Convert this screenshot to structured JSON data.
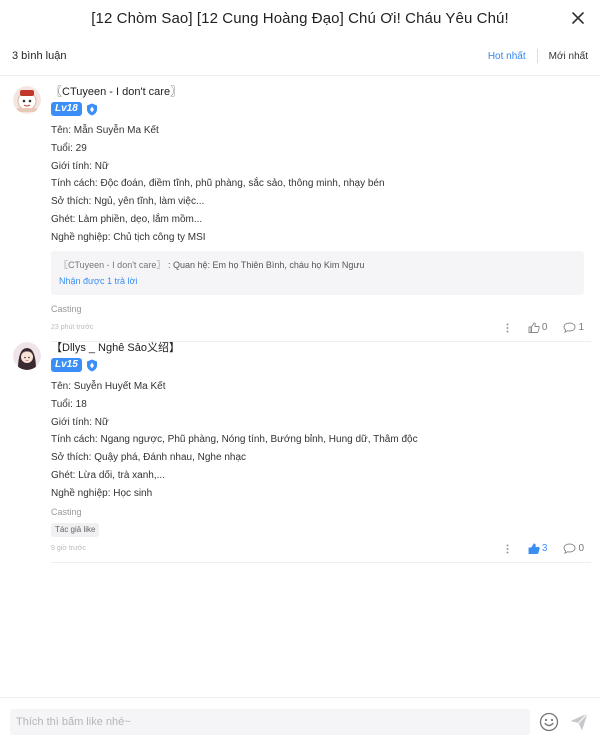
{
  "header": {
    "title": "[12 Chòm Sao] [12 Cung Hoàng Đạo] Chú Ơi! Cháu Yêu Chú!"
  },
  "subbar": {
    "count": "3 bình luận",
    "sort_hot": "Hot nhất",
    "sort_new": "Mới nhất"
  },
  "comments": [
    {
      "username": "〖CTuyeen - I don't care〗",
      "level": "Lv18",
      "lines": [
        "Tên: Mẫn Suyễn Ma Kết",
        "Tuổi: 29",
        "Giới tính: Nữ",
        "Tính cách: Độc đoán, điềm tĩnh, phũ phàng, sắc sảo, thông minh, nhạy bén",
        "Sở thích: Ngủ, yên tĩnh, làm việc...",
        "Ghét: Làm phiền, dẹo, lắm mồm...",
        "Nghề nghiệp: Chủ tịch công ty MSI"
      ],
      "reply": {
        "author": "〖CTuyeen - I don't care〗",
        "text": " : Quan hệ: Em họ Thiên Bình, cháu họ Kim Ngưu",
        "more": "Nhận được 1 trả lời"
      },
      "tag": "Casting",
      "time": "23 phút trước",
      "likes": "0",
      "replies": "1"
    },
    {
      "username": "【Dllys _ Nghê Sảo义绍】",
      "level": "Lv15",
      "lines": [
        "Tên: Suyễn Huyết Ma Kết",
        "Tuổi: 18",
        "Giới tính: Nữ",
        "Tính cách: Ngang ngược, Phũ phàng, Nóng tính, Bướng bỉnh, Hung dữ, Thâm độc",
        "Sở thích: Quậy phá, Đánh nhau, Nghe nhạc",
        "Ghét: Lừa dối, trà xanh,...",
        "Nghề nghiệp: Học sinh"
      ],
      "tag": "Casting",
      "chip": "Tác giả like",
      "time": "9 giờ trước",
      "likes": "3",
      "replies": "0"
    }
  ],
  "footer": {
    "placeholder": "Thích thì bấm like nhé~"
  },
  "colors": {
    "accent": "#2e86f0",
    "level_badge": "#3a8ef5"
  },
  "icons": [
    "close-icon",
    "shield-icon",
    "more-dots-icon",
    "thumbs-up-icon",
    "comment-bubble-icon",
    "emoji-icon",
    "send-icon"
  ]
}
